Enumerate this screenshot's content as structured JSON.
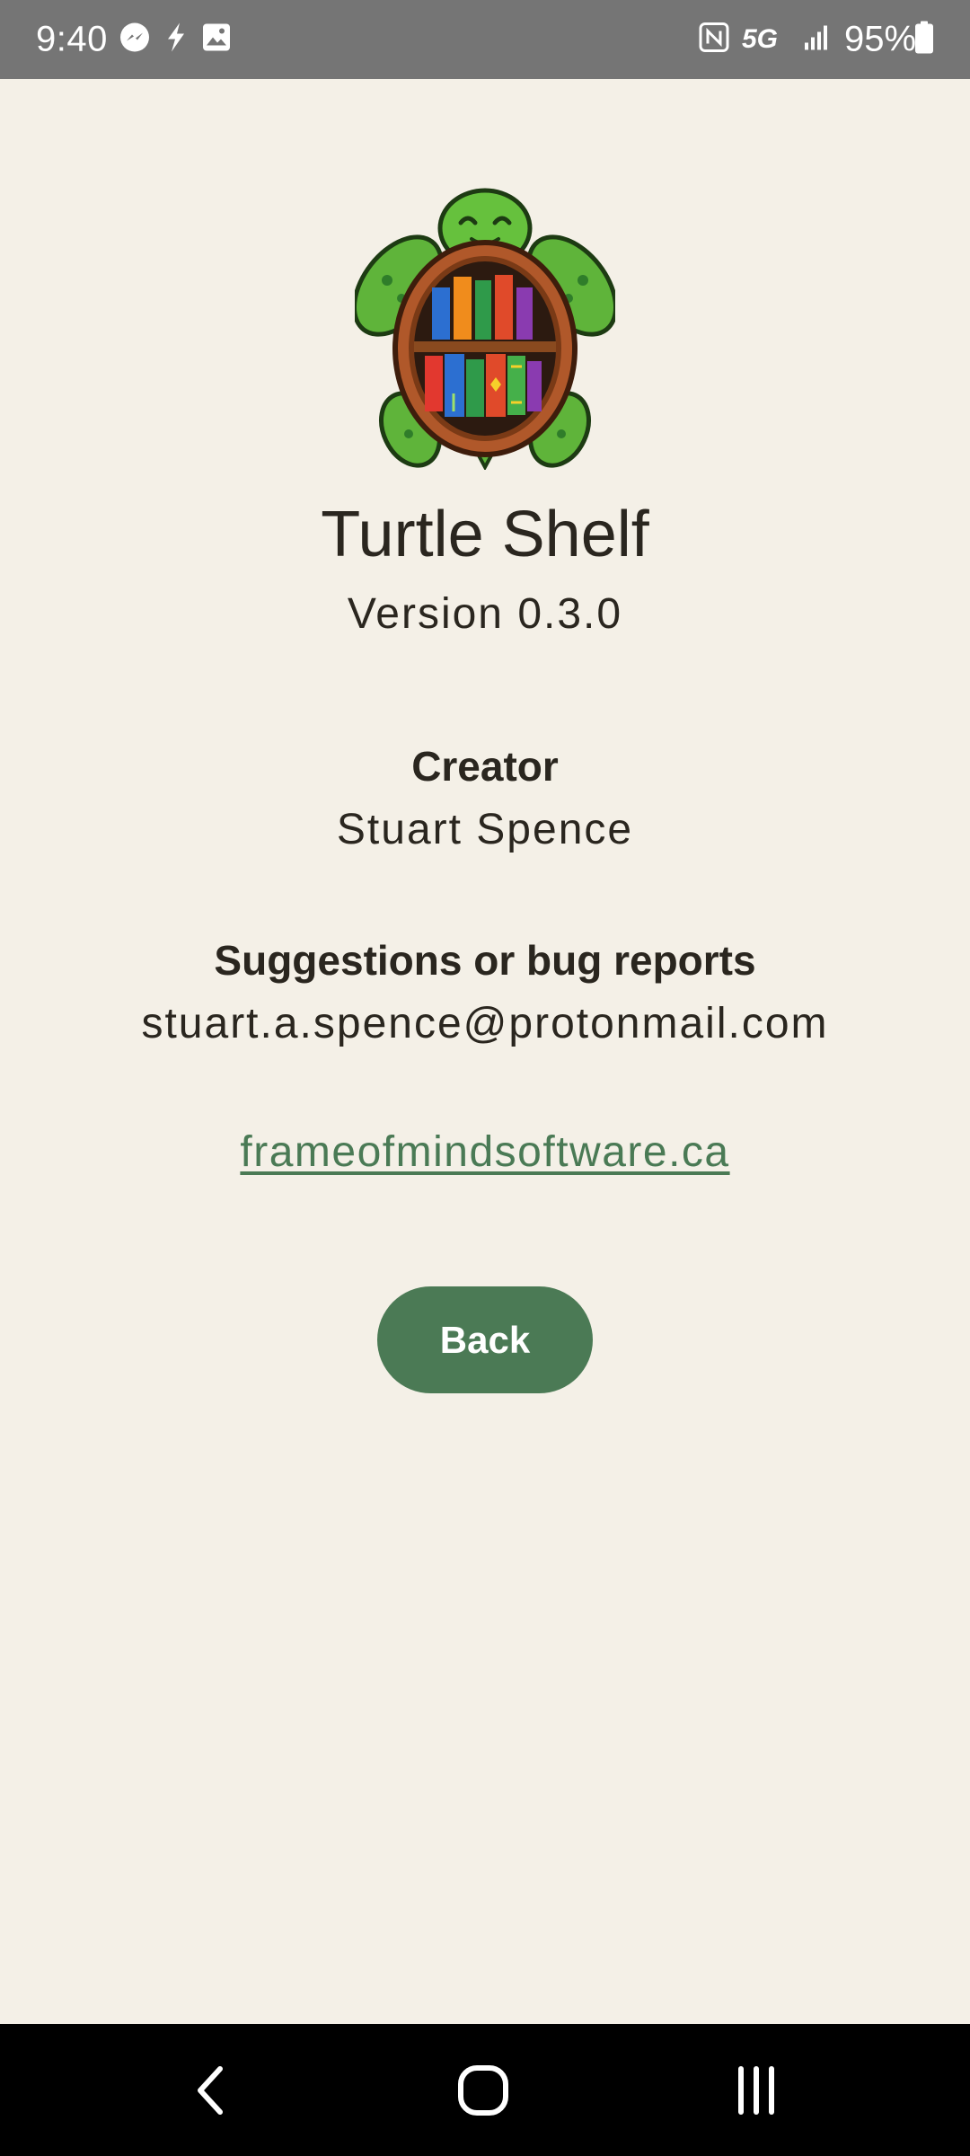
{
  "status_bar": {
    "time": "9:40",
    "network": "5G",
    "battery": "95%",
    "left_icons": [
      "messenger-icon",
      "flash-icon",
      "image-icon"
    ],
    "right_icons": [
      "nfc-icon",
      "5g-icon",
      "signal-icon",
      "battery-icon"
    ]
  },
  "about": {
    "logo_icon": "turtle-bookshelf-logo",
    "app_title": "Turtle Shelf",
    "version": "Version 0.3.0",
    "creator_heading": "Creator",
    "creator_name": "Stuart Spence",
    "suggestions_heading": "Suggestions or bug reports",
    "email": "stuart.a.spence@protonmail.com",
    "website": "frameofmindsoftware.ca",
    "back_label": "Back"
  },
  "nav_bar": {
    "items": [
      "back-nav-icon",
      "home-nav-icon",
      "recents-nav-icon"
    ]
  },
  "colors": {
    "background": "#f4f0e7",
    "accent": "#4b7a55",
    "link": "#4a7a55",
    "text": "#2a261f",
    "status_bar": "#757575"
  }
}
